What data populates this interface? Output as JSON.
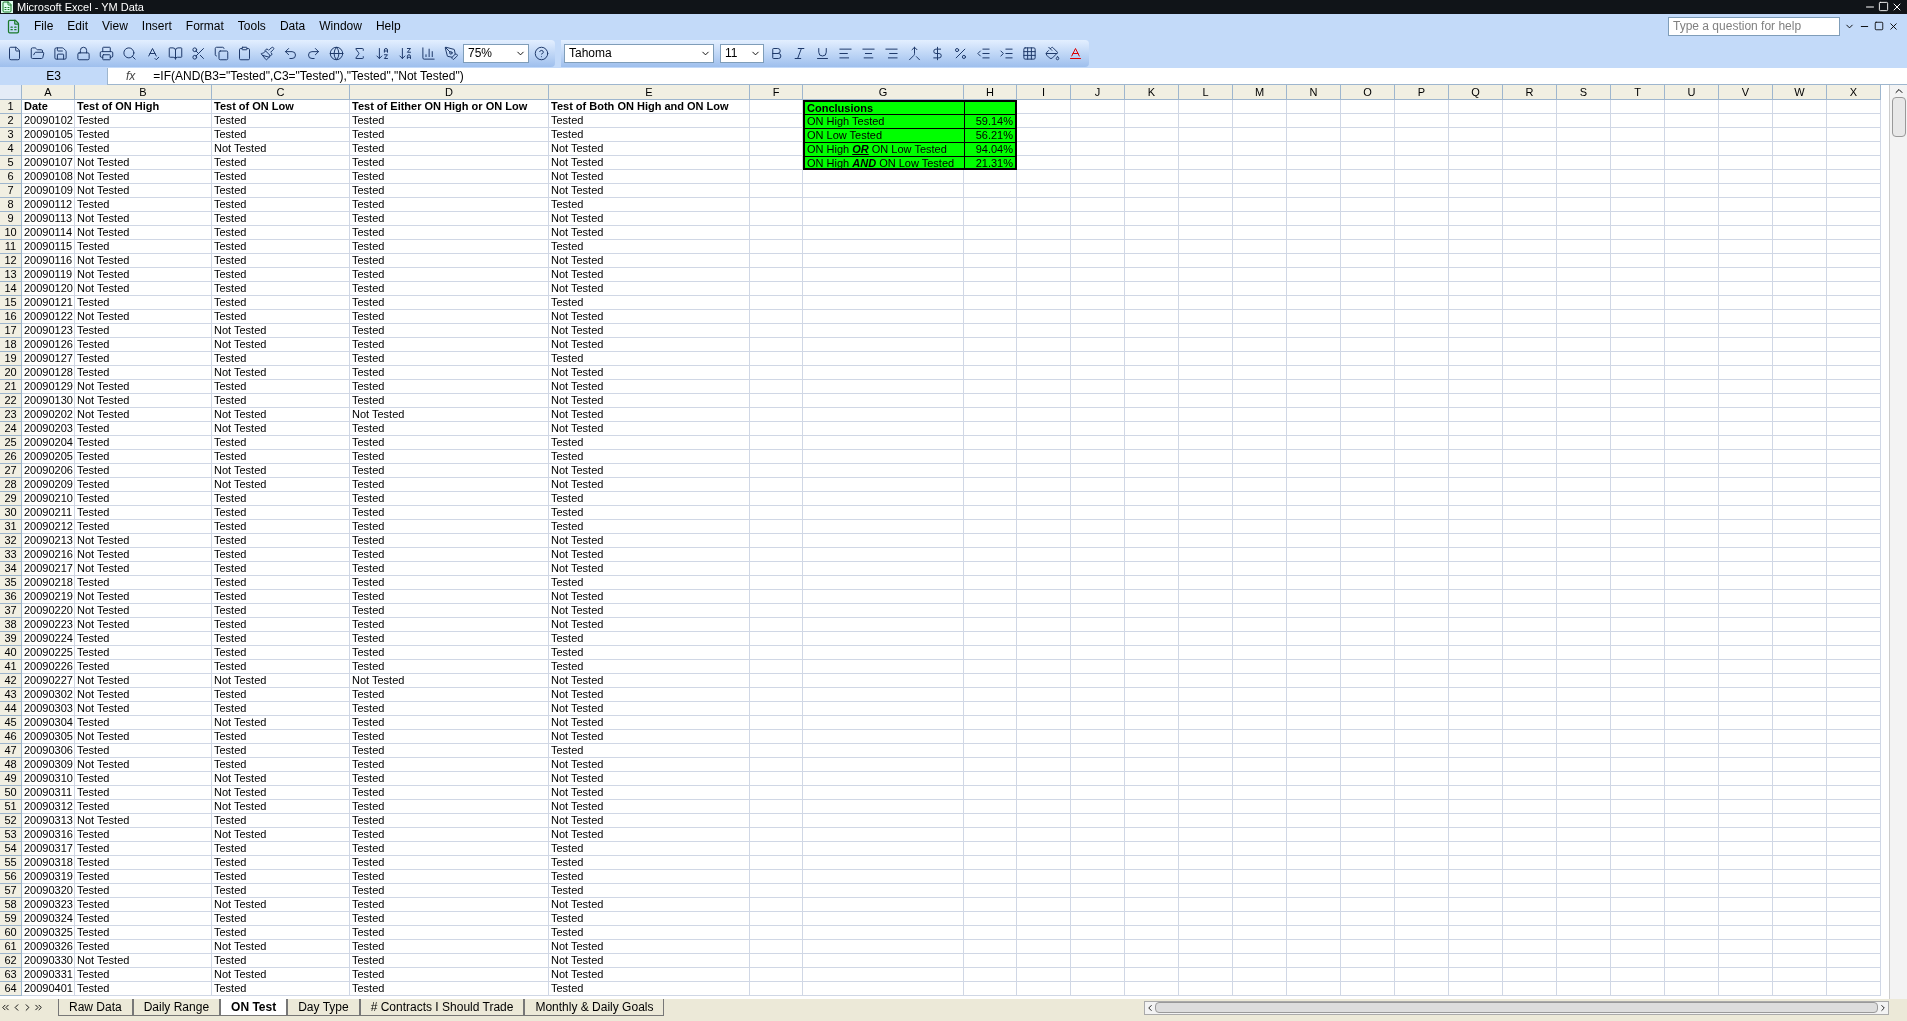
{
  "window": {
    "title": "Microsoft Excel - YM Data"
  },
  "menu": [
    "File",
    "Edit",
    "View",
    "Insert",
    "Format",
    "Tools",
    "Data",
    "Window",
    "Help"
  ],
  "help_box": {
    "placeholder": "Type a question for help"
  },
  "toolbar": {
    "zoom": "75%",
    "font": "Tahoma",
    "font_size": "11"
  },
  "formula_bar": {
    "name_box": "E3",
    "fx": "fx",
    "formula": "=IF(AND(B3=\"Tested\",C3=\"Tested\"),\"Tested\",\"Not Tested\")"
  },
  "sheet": {
    "column_letters": [
      "A",
      "B",
      "C",
      "D",
      "E",
      "F",
      "G",
      "H",
      "I",
      "J",
      "K",
      "L",
      "M",
      "N",
      "O",
      "P",
      "Q",
      "R",
      "S",
      "T",
      "U",
      "V",
      "W",
      "X"
    ],
    "header_row": {
      "n": "1",
      "cells": [
        "Date",
        "Test of ON High",
        "Test of ON Low",
        "Test of Either ON High or ON Low",
        "Test of Both ON High and ON Low"
      ]
    },
    "rows": [
      {
        "n": "2",
        "cells": [
          "20090102",
          "Tested",
          "Tested",
          "Tested",
          "Tested"
        ]
      },
      {
        "n": "3",
        "cells": [
          "20090105",
          "Tested",
          "Tested",
          "Tested",
          "Tested"
        ]
      },
      {
        "n": "4",
        "cells": [
          "20090106",
          "Tested",
          "Not Tested",
          "Tested",
          "Not Tested"
        ]
      },
      {
        "n": "5",
        "cells": [
          "20090107",
          "Not Tested",
          "Tested",
          "Tested",
          "Not Tested"
        ]
      },
      {
        "n": "6",
        "cells": [
          "20090108",
          "Not Tested",
          "Tested",
          "Tested",
          "Not Tested"
        ]
      },
      {
        "n": "7",
        "cells": [
          "20090109",
          "Not Tested",
          "Tested",
          "Tested",
          "Not Tested"
        ]
      },
      {
        "n": "8",
        "cells": [
          "20090112",
          "Tested",
          "Tested",
          "Tested",
          "Tested"
        ]
      },
      {
        "n": "9",
        "cells": [
          "20090113",
          "Not Tested",
          "Tested",
          "Tested",
          "Not Tested"
        ]
      },
      {
        "n": "10",
        "cells": [
          "20090114",
          "Not Tested",
          "Tested",
          "Tested",
          "Not Tested"
        ]
      },
      {
        "n": "11",
        "cells": [
          "20090115",
          "Tested",
          "Tested",
          "Tested",
          "Tested"
        ]
      },
      {
        "n": "12",
        "cells": [
          "20090116",
          "Not Tested",
          "Tested",
          "Tested",
          "Not Tested"
        ]
      },
      {
        "n": "13",
        "cells": [
          "20090119",
          "Not Tested",
          "Tested",
          "Tested",
          "Not Tested"
        ]
      },
      {
        "n": "14",
        "cells": [
          "20090120",
          "Not Tested",
          "Tested",
          "Tested",
          "Not Tested"
        ]
      },
      {
        "n": "15",
        "cells": [
          "20090121",
          "Tested",
          "Tested",
          "Tested",
          "Tested"
        ]
      },
      {
        "n": "16",
        "cells": [
          "20090122",
          "Not Tested",
          "Tested",
          "Tested",
          "Not Tested"
        ]
      },
      {
        "n": "17",
        "cells": [
          "20090123",
          "Tested",
          "Not Tested",
          "Tested",
          "Not Tested"
        ]
      },
      {
        "n": "18",
        "cells": [
          "20090126",
          "Tested",
          "Not Tested",
          "Tested",
          "Not Tested"
        ]
      },
      {
        "n": "19",
        "cells": [
          "20090127",
          "Tested",
          "Tested",
          "Tested",
          "Tested"
        ]
      },
      {
        "n": "20",
        "cells": [
          "20090128",
          "Tested",
          "Not Tested",
          "Tested",
          "Not Tested"
        ]
      },
      {
        "n": "21",
        "cells": [
          "20090129",
          "Not Tested",
          "Tested",
          "Tested",
          "Not Tested"
        ]
      },
      {
        "n": "22",
        "cells": [
          "20090130",
          "Not Tested",
          "Tested",
          "Tested",
          "Not Tested"
        ]
      },
      {
        "n": "23",
        "cells": [
          "20090202",
          "Not Tested",
          "Not Tested",
          "Not Tested",
          "Not Tested"
        ]
      },
      {
        "n": "24",
        "cells": [
          "20090203",
          "Tested",
          "Not Tested",
          "Tested",
          "Not Tested"
        ]
      },
      {
        "n": "25",
        "cells": [
          "20090204",
          "Tested",
          "Tested",
          "Tested",
          "Tested"
        ]
      },
      {
        "n": "26",
        "cells": [
          "20090205",
          "Tested",
          "Tested",
          "Tested",
          "Tested"
        ]
      },
      {
        "n": "27",
        "cells": [
          "20090206",
          "Tested",
          "Not Tested",
          "Tested",
          "Not Tested"
        ]
      },
      {
        "n": "28",
        "cells": [
          "20090209",
          "Tested",
          "Not Tested",
          "Tested",
          "Not Tested"
        ]
      },
      {
        "n": "29",
        "cells": [
          "20090210",
          "Tested",
          "Tested",
          "Tested",
          "Tested"
        ]
      },
      {
        "n": "30",
        "cells": [
          "20090211",
          "Tested",
          "Tested",
          "Tested",
          "Tested"
        ]
      },
      {
        "n": "31",
        "cells": [
          "20090212",
          "Tested",
          "Tested",
          "Tested",
          "Tested"
        ]
      },
      {
        "n": "32",
        "cells": [
          "20090213",
          "Not Tested",
          "Tested",
          "Tested",
          "Not Tested"
        ]
      },
      {
        "n": "33",
        "cells": [
          "20090216",
          "Not Tested",
          "Tested",
          "Tested",
          "Not Tested"
        ]
      },
      {
        "n": "34",
        "cells": [
          "20090217",
          "Not Tested",
          "Tested",
          "Tested",
          "Not Tested"
        ]
      },
      {
        "n": "35",
        "cells": [
          "20090218",
          "Tested",
          "Tested",
          "Tested",
          "Tested"
        ]
      },
      {
        "n": "36",
        "cells": [
          "20090219",
          "Not Tested",
          "Tested",
          "Tested",
          "Not Tested"
        ]
      },
      {
        "n": "37",
        "cells": [
          "20090220",
          "Not Tested",
          "Tested",
          "Tested",
          "Not Tested"
        ]
      },
      {
        "n": "38",
        "cells": [
          "20090223",
          "Not Tested",
          "Tested",
          "Tested",
          "Not Tested"
        ]
      },
      {
        "n": "39",
        "cells": [
          "20090224",
          "Tested",
          "Tested",
          "Tested",
          "Tested"
        ]
      },
      {
        "n": "40",
        "cells": [
          "20090225",
          "Tested",
          "Tested",
          "Tested",
          "Tested"
        ]
      },
      {
        "n": "41",
        "cells": [
          "20090226",
          "Tested",
          "Tested",
          "Tested",
          "Tested"
        ]
      },
      {
        "n": "42",
        "cells": [
          "20090227",
          "Not Tested",
          "Not Tested",
          "Not Tested",
          "Not Tested"
        ]
      },
      {
        "n": "43",
        "cells": [
          "20090302",
          "Not Tested",
          "Tested",
          "Tested",
          "Not Tested"
        ]
      },
      {
        "n": "44",
        "cells": [
          "20090303",
          "Not Tested",
          "Tested",
          "Tested",
          "Not Tested"
        ]
      },
      {
        "n": "45",
        "cells": [
          "20090304",
          "Tested",
          "Not Tested",
          "Tested",
          "Not Tested"
        ]
      },
      {
        "n": "46",
        "cells": [
          "20090305",
          "Not Tested",
          "Tested",
          "Tested",
          "Not Tested"
        ]
      },
      {
        "n": "47",
        "cells": [
          "20090306",
          "Tested",
          "Tested",
          "Tested",
          "Tested"
        ]
      },
      {
        "n": "48",
        "cells": [
          "20090309",
          "Not Tested",
          "Tested",
          "Tested",
          "Not Tested"
        ]
      },
      {
        "n": "49",
        "cells": [
          "20090310",
          "Tested",
          "Not Tested",
          "Tested",
          "Not Tested"
        ]
      },
      {
        "n": "50",
        "cells": [
          "20090311",
          "Tested",
          "Not Tested",
          "Tested",
          "Not Tested"
        ]
      },
      {
        "n": "51",
        "cells": [
          "20090312",
          "Tested",
          "Not Tested",
          "Tested",
          "Not Tested"
        ]
      },
      {
        "n": "52",
        "cells": [
          "20090313",
          "Not Tested",
          "Tested",
          "Tested",
          "Not Tested"
        ]
      },
      {
        "n": "53",
        "cells": [
          "20090316",
          "Tested",
          "Not Tested",
          "Tested",
          "Not Tested"
        ]
      },
      {
        "n": "54",
        "cells": [
          "20090317",
          "Tested",
          "Tested",
          "Tested",
          "Tested"
        ]
      },
      {
        "n": "55",
        "cells": [
          "20090318",
          "Tested",
          "Tested",
          "Tested",
          "Tested"
        ]
      },
      {
        "n": "56",
        "cells": [
          "20090319",
          "Tested",
          "Tested",
          "Tested",
          "Tested"
        ]
      },
      {
        "n": "57",
        "cells": [
          "20090320",
          "Tested",
          "Tested",
          "Tested",
          "Tested"
        ]
      },
      {
        "n": "58",
        "cells": [
          "20090323",
          "Tested",
          "Not Tested",
          "Tested",
          "Not Tested"
        ]
      },
      {
        "n": "59",
        "cells": [
          "20090324",
          "Tested",
          "Tested",
          "Tested",
          "Tested"
        ]
      },
      {
        "n": "60",
        "cells": [
          "20090325",
          "Tested",
          "Tested",
          "Tested",
          "Tested"
        ]
      },
      {
        "n": "61",
        "cells": [
          "20090326",
          "Tested",
          "Not Tested",
          "Tested",
          "Not Tested"
        ]
      },
      {
        "n": "62",
        "cells": [
          "20090330",
          "Not Tested",
          "Tested",
          "Tested",
          "Not Tested"
        ]
      },
      {
        "n": "63",
        "cells": [
          "20090331",
          "Tested",
          "Not Tested",
          "Tested",
          "Not Tested"
        ]
      },
      {
        "n": "64",
        "cells": [
          "20090401",
          "Tested",
          "Tested",
          "Tested",
          "Tested"
        ]
      }
    ],
    "conclusions": {
      "title": "Conclusions",
      "items": [
        {
          "label": "ON High Tested",
          "value": "59.14%"
        },
        {
          "label": "ON Low Tested",
          "value": "56.21%"
        },
        {
          "label": "ON High **OR** ON Low Tested",
          "value": "94.04%"
        },
        {
          "label": "ON High **AND** ON Low Tested",
          "value": "21.31%"
        }
      ]
    }
  },
  "sheet_tabs": [
    {
      "label": "Raw Data",
      "selected": false
    },
    {
      "label": "Daily Range",
      "selected": false
    },
    {
      "label": "ON Test",
      "selected": true
    },
    {
      "label": "Day Type",
      "selected": false
    },
    {
      "label": "# Contracts I Should Trade",
      "selected": false
    },
    {
      "label": "Monthly & Daily Goals",
      "selected": false
    }
  ]
}
